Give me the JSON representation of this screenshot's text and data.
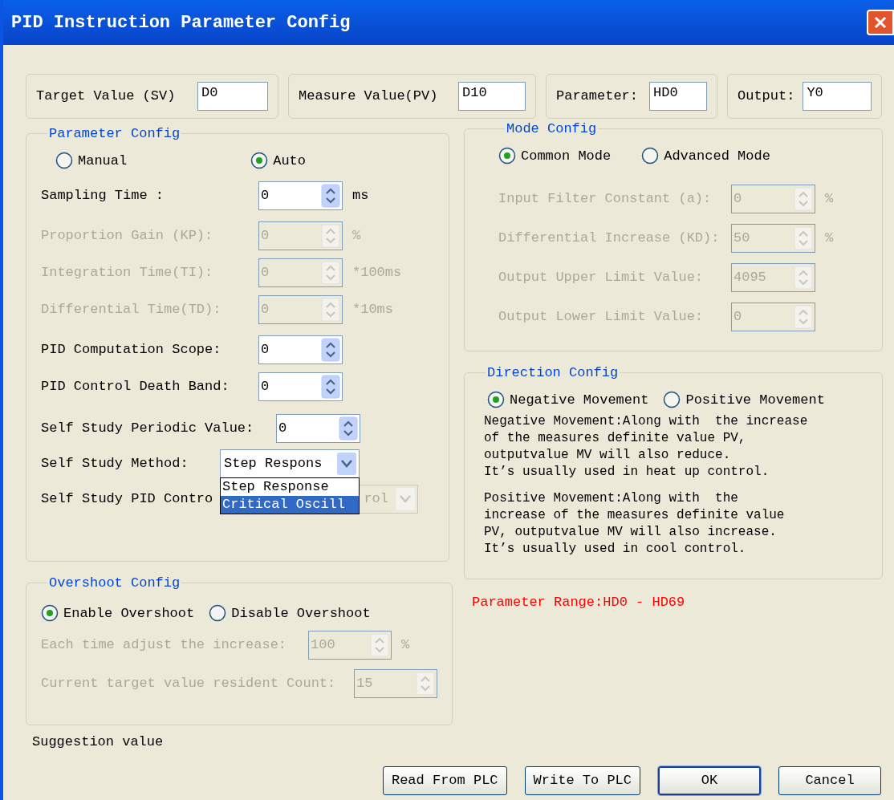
{
  "window": {
    "title": "PID Instruction Parameter Config"
  },
  "top_fields": [
    {
      "label": "Target Value (SV)",
      "value": "D0"
    },
    {
      "label": "Measure Value(PV)",
      "value": "D10"
    },
    {
      "label": "Parameter:",
      "value": "HD0"
    },
    {
      "label": "Output:",
      "value": "Y0"
    }
  ],
  "parameter_config": {
    "title": "Parameter Config",
    "modes": [
      {
        "label": "Manual",
        "selected": false
      },
      {
        "label": "Auto",
        "selected": true
      }
    ],
    "groups": [
      [
        {
          "label": "Sampling Time :",
          "value": "0",
          "unit": "ms",
          "disabled": false
        }
      ],
      [
        {
          "label": "Proportion Gain (KP):",
          "value": "0",
          "unit": "%",
          "disabled": true
        },
        {
          "label": "Integration Time(TI):",
          "value": "0",
          "unit": "*100ms",
          "disabled": true
        },
        {
          "label": "Differential Time(TD):",
          "value": "0",
          "unit": "*10ms",
          "disabled": true
        }
      ],
      [
        {
          "label": "PID Computation Scope:",
          "value": "0",
          "disabled": false
        },
        {
          "label": "PID Control Death Band:",
          "value": "0",
          "disabled": false
        }
      ]
    ],
    "self_study": [
      {
        "kind": "spin",
        "label": "Self Study Periodic Value:",
        "value": "0",
        "disabled": false
      },
      {
        "kind": "combo",
        "label": "Self Study Method:",
        "value": "Step Respons",
        "disabled": false,
        "open": true
      },
      {
        "kind": "combo",
        "label": "Self Study PID Contro",
        "value": "rol",
        "disabled": true,
        "open": false
      }
    ],
    "dropdown_options": [
      {
        "label": "Step Response",
        "selected": false
      },
      {
        "label": "Critical Oscill",
        "selected": true
      }
    ]
  },
  "overshoot_config": {
    "title": "Overshoot Config",
    "modes": [
      {
        "label": "Enable Overshoot",
        "selected": true
      },
      {
        "label": "Disable Overshoot",
        "selected": false
      }
    ],
    "rows": [
      {
        "label": "Each time adjust the increase:",
        "value": "100",
        "unit": "%",
        "disabled": true
      },
      {
        "label": "Current target value resident Count:",
        "value": "15",
        "disabled": true
      }
    ]
  },
  "suggestion": "Suggestion value",
  "mode_config": {
    "title": "Mode Config",
    "modes": [
      {
        "label": "Common Mode",
        "selected": true
      },
      {
        "label": "Advanced Mode",
        "selected": false
      }
    ],
    "rows": [
      {
        "label": "Input Filter Constant (a):",
        "value": "0",
        "unit": "%",
        "disabled": true
      },
      {
        "label": "Differential Increase (KD):",
        "value": "50",
        "unit": "%",
        "disabled": true
      },
      {
        "label": "Output Upper Limit Value:",
        "value": "4095",
        "disabled": true
      },
      {
        "label": "Output Lower Limit Value:",
        "value": "0",
        "disabled": true
      }
    ]
  },
  "direction_config": {
    "title": "Direction Config",
    "modes": [
      {
        "label": "Negative Movement",
        "selected": true
      },
      {
        "label": "Positive Movement",
        "selected": false
      }
    ],
    "notes": [
      "Negative Movement:Along with  the increase\nof the measures definite value PV,\noutputvalue MV will also reduce.\nIt’s usually used in heat up control.",
      "Positive Movement:Along with  the\nincrease of the measures definite value\nPV, outputvalue MV will also increase.\nIt’s usually used in cool control."
    ]
  },
  "parameter_range": "Parameter Range:HD0 - HD69",
  "buttons": [
    {
      "label": "Read From PLC",
      "default": false
    },
    {
      "label": "Write To PLC",
      "default": false
    },
    {
      "label": "OK",
      "default": true
    },
    {
      "label": "Cancel",
      "default": false
    }
  ]
}
